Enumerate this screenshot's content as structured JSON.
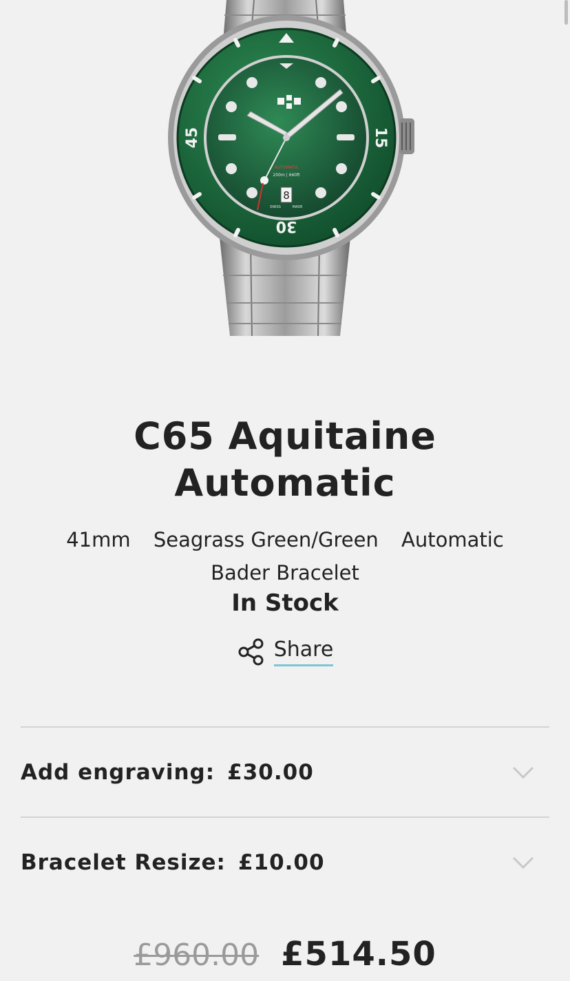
{
  "product": {
    "image_alt": "Watch product image",
    "title_line1": "C65 Aquitaine",
    "title_line2": "Automatic",
    "spec_size": "41mm",
    "spec_color": "Seagrass Green/Green",
    "spec_movement": "Automatic",
    "spec_strap": "Bader Bracelet",
    "stock_status": "In Stock",
    "share_label": "Share",
    "dial": {
      "bezel_45": "45",
      "bezel_15": "15",
      "bezel_30": "30",
      "automatic": "AUTOMATIC",
      "depth": "200m | 660ft",
      "swiss": "SWISS",
      "made": "MADE",
      "date": "8"
    }
  },
  "options": [
    {
      "label": "Add engraving:",
      "price": "£30.00"
    },
    {
      "label": "Bracelet Resize:",
      "price": "£10.00"
    }
  ],
  "pricing": {
    "old_price": "£960.00",
    "new_price": "£514.50"
  },
  "colors": {
    "background": "#f1f1f1",
    "bezel_green": "#1f6b3d",
    "dial_green": "#1c5a3a",
    "share_underline": "#7ac6d6",
    "text": "#222222",
    "old_price": "#9a9a9a"
  },
  "icons": {
    "share": "share-icon",
    "expand": "chevron-down-icon"
  }
}
